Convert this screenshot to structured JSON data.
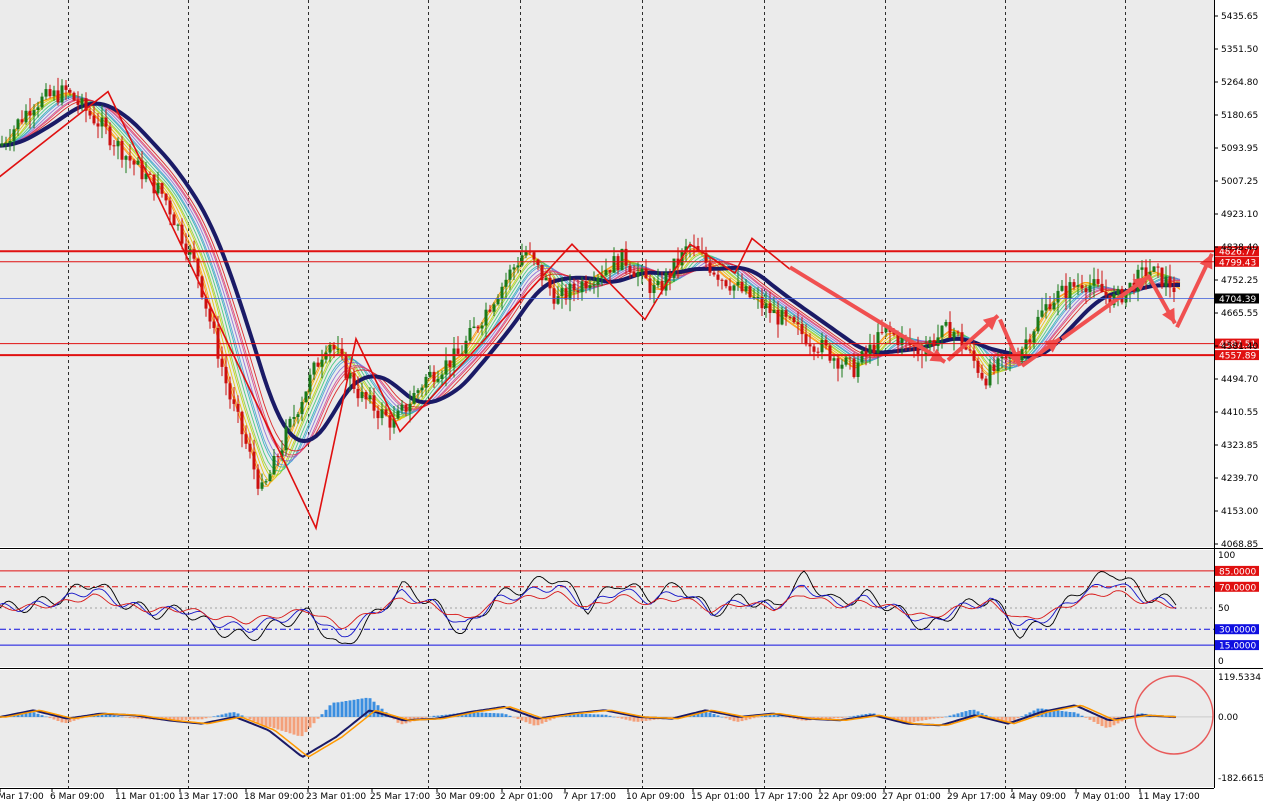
{
  "chart_data": [
    {
      "type": "candlestick",
      "y_ticks": [
        "5435.65",
        "5351.50",
        "5264.80",
        "5180.65",
        "5093.95",
        "5007.25",
        "4923.10",
        "4838.40",
        "4752.25",
        "4665.55",
        "4581.40",
        "4494.70",
        "4410.55",
        "4323.85",
        "4239.70",
        "4153.00",
        "4068.85"
      ],
      "x_ticks": [
        "Mar 17:00",
        "6 Mar 09:00",
        "11 Mar 01:00",
        "13 Mar 17:00",
        "18 Mar 09:00",
        "23 Mar 01:00",
        "25 Mar 17:00",
        "30 Mar 09:00",
        "2 Apr 01:00",
        "7 Apr 17:00",
        "10 Apr 09:00",
        "15 Apr 01:00",
        "17 Apr 17:00",
        "22 Apr 09:00",
        "27 Apr 01:00",
        "29 Apr 17:00",
        "4 May 09:00",
        "7 May 01:00",
        "11 May 17:00"
      ],
      "ylim": [
        4068.85,
        5435.65
      ],
      "levels": [
        {
          "label": "4826.77",
          "value": 4826.77,
          "color": "#e01010",
          "bold": true
        },
        {
          "label": "4799.43",
          "value": 4799.43,
          "color": "#e01010",
          "bold": false
        },
        {
          "label": "4587.51",
          "value": 4587.51,
          "color": "#e01010",
          "bold": false
        },
        {
          "label": "4557.89",
          "value": 4557.89,
          "color": "#e01010",
          "bold": true
        }
      ],
      "current_price": "4704.39",
      "price_path": [
        5100,
        5210,
        5240,
        5160,
        5060,
        4970,
        4780,
        4450,
        4200,
        4410,
        4600,
        4450,
        4380,
        4500,
        4560,
        4700,
        4830,
        4700,
        4760,
        4810,
        4720,
        4840,
        4760,
        4700,
        4640,
        4580,
        4520,
        4620,
        4570,
        4630,
        4500,
        4560,
        4700,
        4750,
        4700,
        4780,
        4720,
        4705
      ],
      "zigzag": [
        [
          -10,
          5000
        ],
        [
          108,
          5240
        ],
        [
          316,
          4110
        ],
        [
          356,
          4600
        ],
        [
          400,
          4360
        ],
        [
          572,
          4845
        ],
        [
          645,
          4650
        ],
        [
          690,
          4845
        ],
        [
          735,
          4770
        ],
        [
          752,
          4860
        ],
        [
          790,
          4780
        ]
      ],
      "arrows": [
        [
          [
            790,
            4785
          ],
          [
            945,
            4540
          ]
        ],
        [
          [
            948,
            4545
          ],
          [
            998,
            4660
          ]
        ],
        [
          [
            1000,
            4650
          ],
          [
            1020,
            4530
          ]
        ],
        [
          [
            1022,
            4530
          ],
          [
            1060,
            4600
          ]
        ],
        [
          [
            1062,
            4600
          ],
          [
            1148,
            4760
          ]
        ],
        [
          [
            1148,
            4765
          ],
          [
            1175,
            4640
          ]
        ],
        [
          [
            1177,
            4630
          ],
          [
            1212,
            4820
          ]
        ]
      ]
    },
    {
      "type": "line",
      "y_ticks": [
        "100",
        "85.0000",
        "70.0000",
        "50",
        "30.0000",
        "15.0000",
        "0"
      ],
      "ylim": [
        0,
        100
      ],
      "levels": [
        {
          "label": "85.0000",
          "value": 85,
          "color": "#e01010"
        },
        {
          "label": "70.0000",
          "value": 70,
          "color": "#e01010"
        },
        {
          "label": "30.0000",
          "value": 30,
          "color": "#1010e0"
        },
        {
          "label": "15.0000",
          "value": 15,
          "color": "#1010e0"
        }
      ],
      "series_path": [
        50,
        52,
        60,
        75,
        55,
        45,
        48,
        30,
        22,
        35,
        45,
        10,
        40,
        70,
        55,
        25,
        60,
        70,
        80,
        50,
        75,
        60,
        72,
        45,
        60,
        50,
        80,
        55,
        62,
        48,
        30,
        50,
        60,
        25,
        40,
        70,
        85,
        62,
        55
      ]
    },
    {
      "type": "line",
      "y_ticks": [
        "119.5334",
        "0.00",
        "-182.6615"
      ],
      "ylim": [
        -182.6615,
        119.5334
      ],
      "series_path": [
        0,
        20,
        -5,
        10,
        5,
        -10,
        -20,
        0,
        -40,
        -120,
        -60,
        20,
        -10,
        -5,
        15,
        30,
        -5,
        10,
        20,
        0,
        -5,
        20,
        0,
        10,
        -5,
        -10,
        5,
        -20,
        -25,
        5,
        -20,
        15,
        35,
        -10,
        5,
        0
      ]
    }
  ]
}
